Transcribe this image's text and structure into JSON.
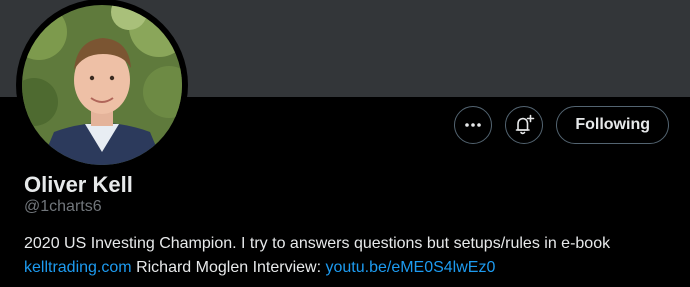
{
  "profile": {
    "name": "Oliver Kell",
    "handle": "@1charts6",
    "bio_line1": "2020 US Investing Champion. I try to answers questions but setups/rules in e-book",
    "bio_link1": "kelltrading.com",
    "bio_text2": "Richard Moglen Interview:",
    "bio_link2": "youtu.be/eME0S4lwEz0"
  },
  "actions": {
    "more_icon": "more-icon",
    "notify_icon": "bell-plus-icon",
    "follow_label": "Following"
  },
  "colors": {
    "background": "#000000",
    "banner": "#333639",
    "text": "#e7e9ea",
    "secondary_text": "#71767b",
    "link": "#1d9bf0",
    "border": "#536471"
  }
}
